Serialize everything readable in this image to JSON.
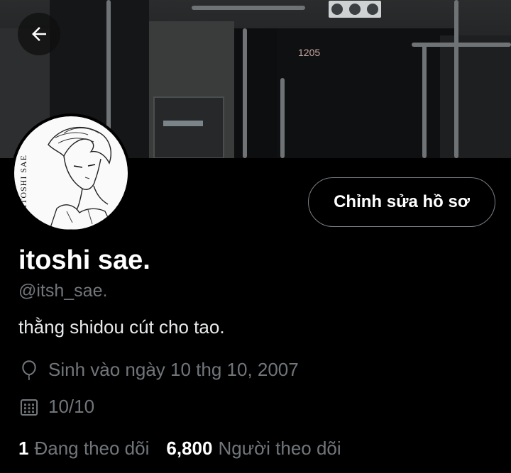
{
  "banner": {
    "bus_number": "1205"
  },
  "header": {
    "back_icon": "arrow-left-icon"
  },
  "profile": {
    "display_name": "itoshi sae.",
    "handle": "@itsh_sae.",
    "bio": "thằng shidou cút cho tao.",
    "avatar_signature": "ITOSHI SAE",
    "edit_button_label": "Chỉnh sửa hồ sơ",
    "birthday_icon": "balloon-icon",
    "birthday": "Sinh vào ngày 10 thg 10, 2007",
    "joined_icon": "calendar-icon",
    "joined": "10/10",
    "following_count": "1",
    "following_label": "Đang theo dõi",
    "followers_count": "6,800",
    "followers_label": "Người theo dõi"
  },
  "colors": {
    "background": "#000000",
    "primary_text": "#ffffff",
    "secondary_text": "#71767b",
    "button_border": "#7a8187"
  }
}
